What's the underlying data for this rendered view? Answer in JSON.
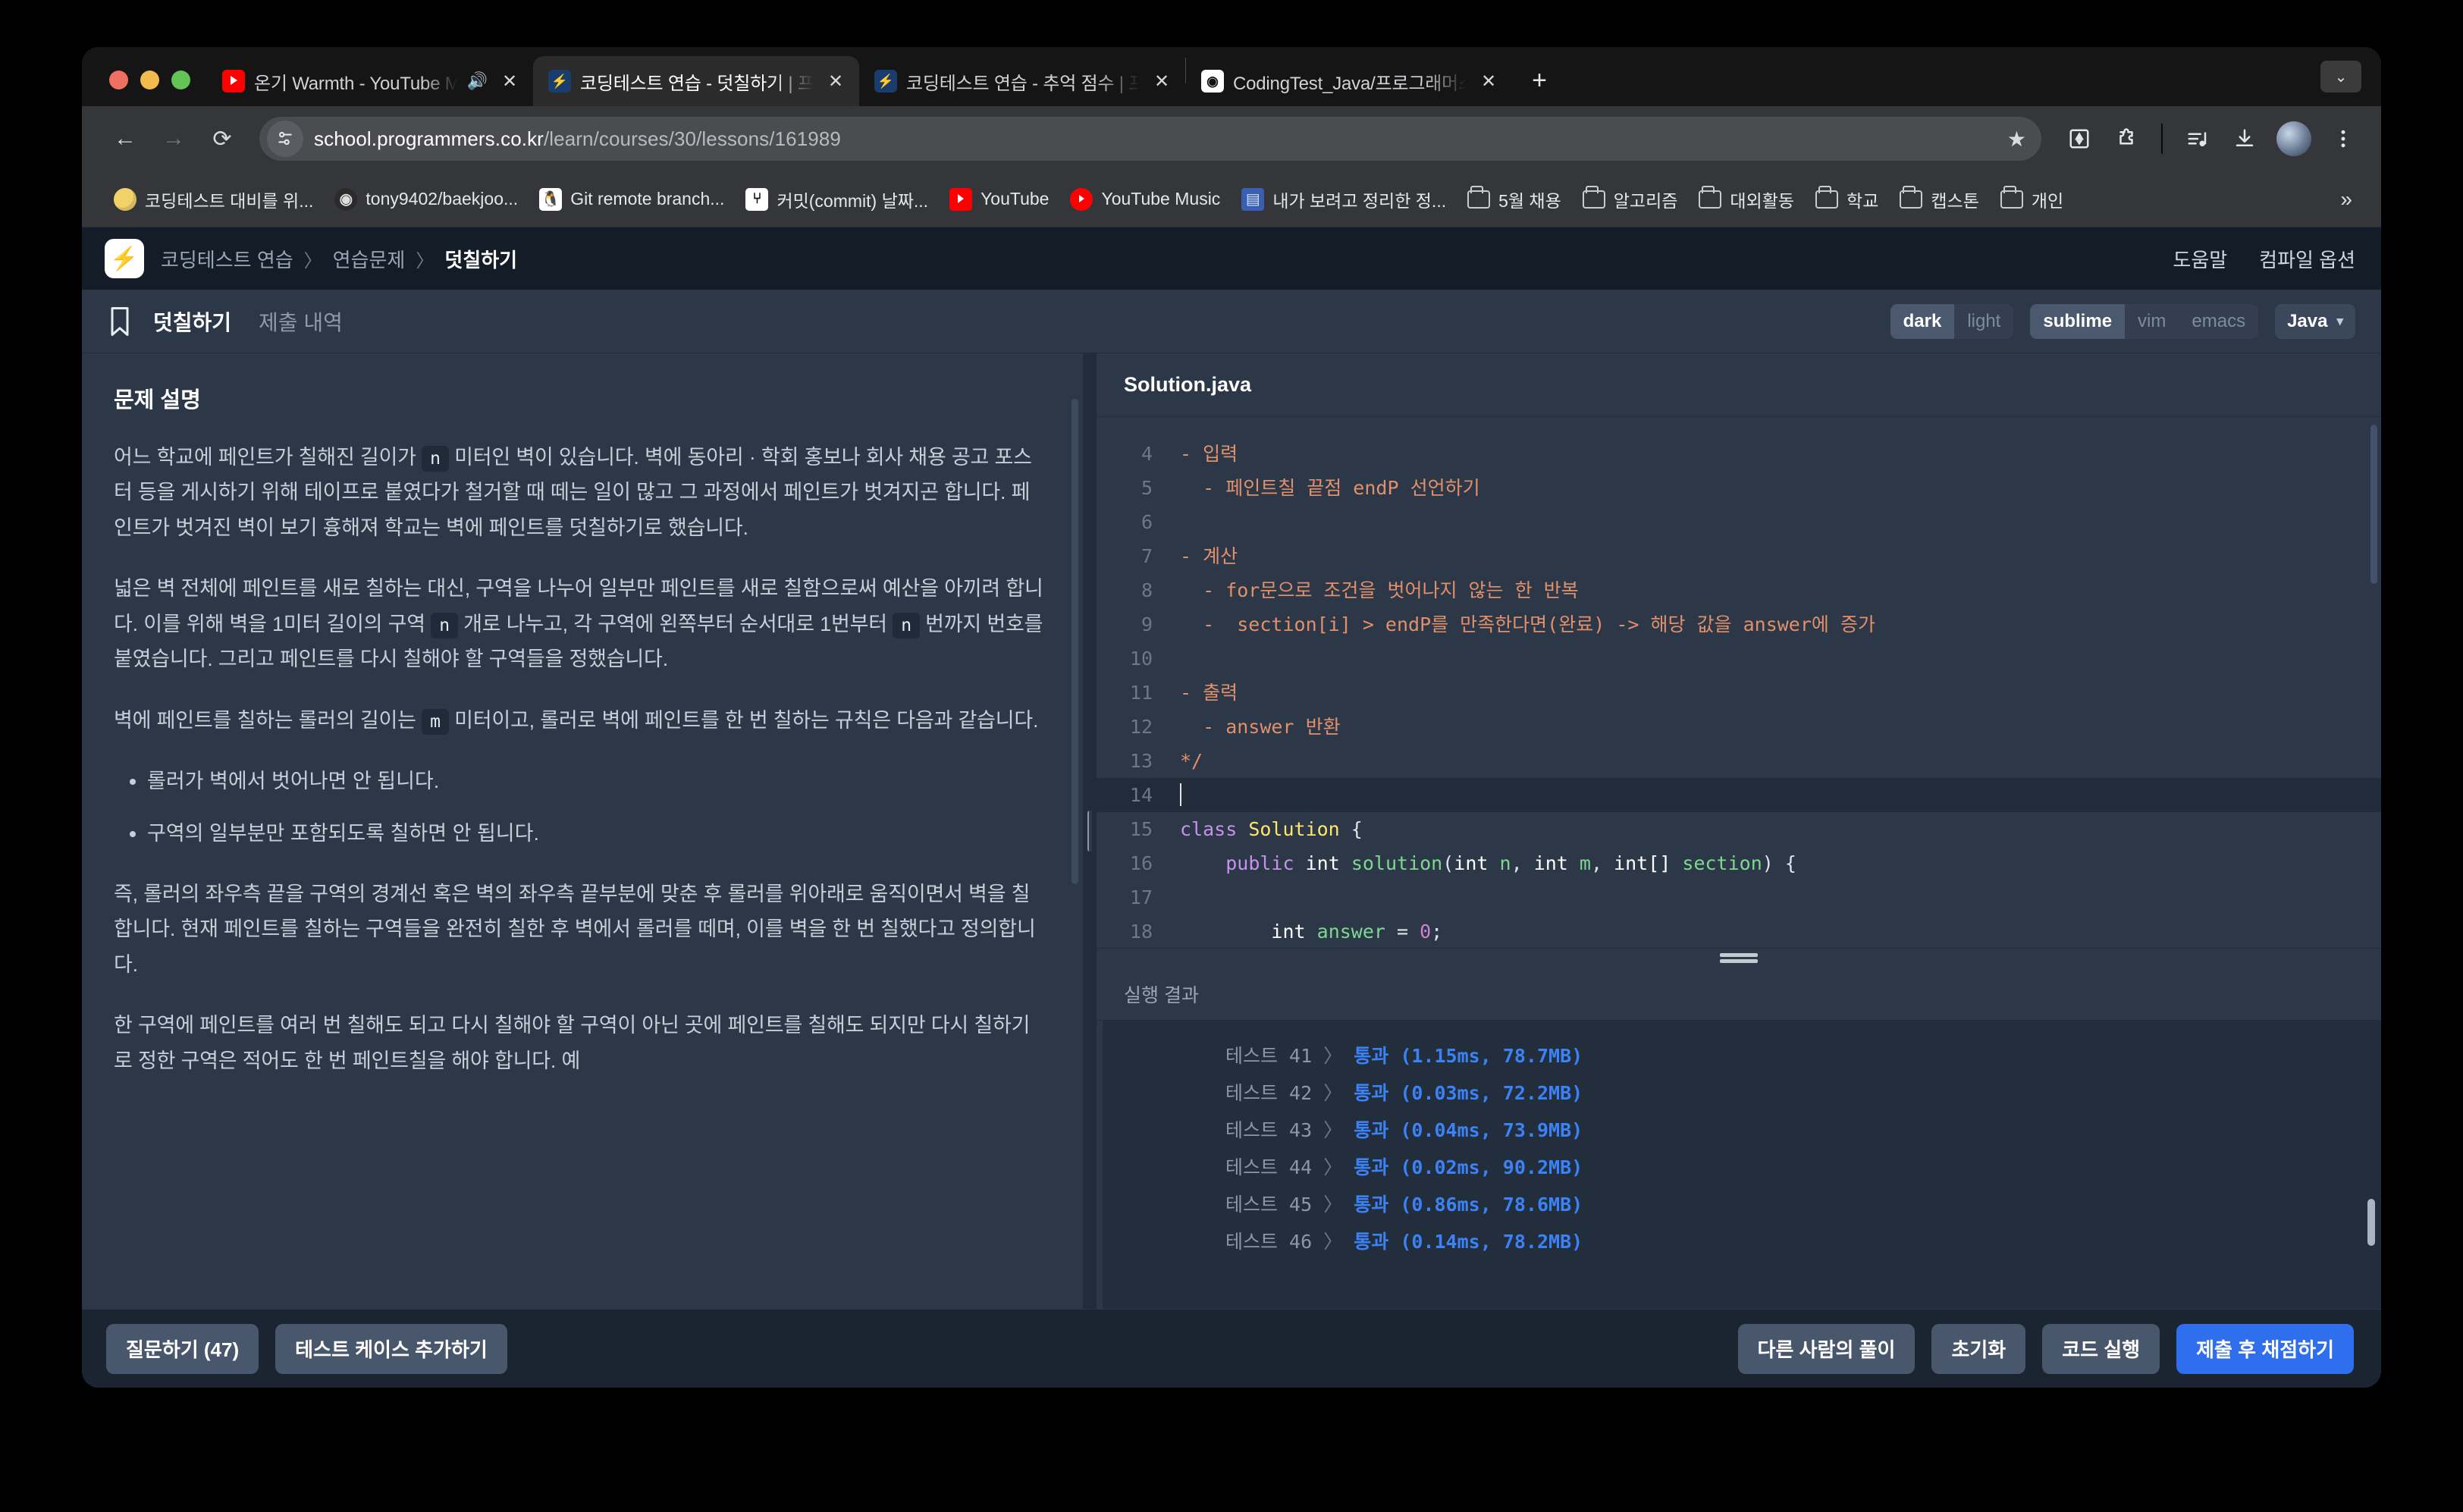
{
  "browser": {
    "tabs": [
      {
        "title": "온기 Warmth - YouTube Mu",
        "favicon": "youtube-icon",
        "audio": "🔊",
        "active": false
      },
      {
        "title": "코딩테스트 연습 - 덧칠하기 | 프로그",
        "favicon": "programmers-icon",
        "audio": "",
        "active": true
      },
      {
        "title": "코딩테스트 연습 - 추억 점수 | 프로그",
        "favicon": "programmers-icon",
        "audio": "",
        "active": false
      },
      {
        "title": "CodingTest_Java/프로그래머스/",
        "favicon": "github-icon",
        "audio": "",
        "active": false
      }
    ],
    "new_tab_label": "+",
    "tab_list_chevron": "⌄",
    "nav": {
      "back": "←",
      "forward": "→",
      "reload": "⟳"
    },
    "omnibox": {
      "host": "school.programmers.co.kr",
      "path": "/learn/courses/30/lessons/161989",
      "site_info_icon": "site-settings-icon",
      "star_icon": "★"
    },
    "toolbar_icons": [
      "reading-list-icon",
      "extensions-icon",
      "media-queue-icon",
      "downloads-icon",
      "profile-avatar",
      "more-menu-icon"
    ],
    "bookmarks": [
      {
        "label": "코딩테스트 대비를 위...",
        "icon": "coin-icon"
      },
      {
        "label": "tony9402/baekjoo...",
        "icon": "github-icon"
      },
      {
        "label": "Git remote branch...",
        "icon": "tux-icon"
      },
      {
        "label": "커밋(commit) 날짜...",
        "icon": "git-icon"
      },
      {
        "label": "YouTube",
        "icon": "youtube-icon"
      },
      {
        "label": "YouTube Music",
        "icon": "youtube-music-icon"
      },
      {
        "label": "내가 보려고 정리한 정...",
        "icon": "note-icon"
      },
      {
        "label": "5월 채용",
        "icon": "folder-icon"
      },
      {
        "label": "알고리즘",
        "icon": "folder-icon"
      },
      {
        "label": "대외활동",
        "icon": "folder-icon"
      },
      {
        "label": "학교",
        "icon": "folder-icon"
      },
      {
        "label": "캡스톤",
        "icon": "folder-icon"
      },
      {
        "label": "개인",
        "icon": "folder-icon"
      }
    ],
    "bookmarks_overflow": "»"
  },
  "site": {
    "logo": "programmers-logo",
    "breadcrumb": [
      "코딩테스트 연습",
      "연습문제",
      "덧칠하기"
    ],
    "breadcrumb_sep": "〉",
    "header_links": [
      "도움말",
      "컴파일 옵션"
    ],
    "tabs": [
      {
        "label": "덧칠하기",
        "active": true
      },
      {
        "label": "제출 내역",
        "active": false
      }
    ],
    "bookmark_icon": "bookmark-icon",
    "theme_toggle": {
      "options": [
        "dark",
        "light"
      ],
      "selected": "dark"
    },
    "keymap_toggle": {
      "options": [
        "sublime",
        "vim",
        "emacs"
      ],
      "selected": "sublime"
    },
    "language_select": {
      "value": "Java",
      "caret": "▾"
    }
  },
  "problem": {
    "title": "문제 설명",
    "paragraphs": [
      {
        "parts": [
          "어느 학교에 페인트가 칠해진 길이가 ",
          {
            "code": "n"
          },
          " 미터인 벽이 있습니다. 벽에 동아리 · 학회 홍보나 회사 채용 공고 포스터 등을 게시하기 위해 테이프로 붙였다가 철거할 때 떼는 일이 많고 그 과정에서 페인트가 벗겨지곤 합니다. 페인트가 벗겨진 벽이 보기 흉해져 학교는 벽에 페인트를 덧칠하기로 했습니다."
        ]
      },
      {
        "parts": [
          "넓은 벽 전체에 페인트를 새로 칠하는 대신, 구역을 나누어 일부만 페인트를 새로 칠함으로써 예산을 아끼려 합니다. 이를 위해 벽을 1미터 길이의 구역 ",
          {
            "code": "n"
          },
          " 개로 나누고, 각 구역에 왼쪽부터 순서대로 1번부터 ",
          {
            "code": "n"
          },
          " 번까지 번호를 붙였습니다. 그리고 페인트를 다시 칠해야 할 구역들을 정했습니다."
        ]
      },
      {
        "parts": [
          "벽에 페인트를 칠하는 롤러의 길이는 ",
          {
            "code": "m"
          },
          " 미터이고, 롤러로 벽에 페인트를 한 번 칠하는 규칙은 다음과 같습니다."
        ]
      }
    ],
    "rules": [
      "롤러가 벽에서 벗어나면 안 됩니다.",
      "구역의 일부분만 포함되도록 칠하면 안 됩니다."
    ],
    "paragraphs_after": [
      "즉, 롤러의 좌우측 끝을 구역의 경계선 혹은 벽의 좌우측 끝부분에 맞춘 후 롤러를 위아래로 움직이면서 벽을 칠합니다. 현재 페인트를 칠하는 구역들을 완전히 칠한 후 벽에서 롤러를 떼며, 이를 벽을 한 번 칠했다고 정의합니다.",
      "한 구역에 페인트를 여러 번 칠해도 되고 다시 칠해야 할 구역이 아닌 곳에 페인트를 칠해도 되지만 다시 칠하기로 정한 구역은 적어도 한 번 페인트칠을 해야 합니다. 예"
    ]
  },
  "editor": {
    "filename": "Solution.java",
    "lines": [
      {
        "num": "4",
        "tokens": [
          {
            "t": "- 입력",
            "c": "cm"
          }
        ]
      },
      {
        "num": "5",
        "tokens": [
          {
            "t": "  - 페인트칠 끝점 endP 선언하기",
            "c": "cm"
          }
        ]
      },
      {
        "num": "6",
        "tokens": [
          {
            "t": "",
            "c": "cm"
          }
        ]
      },
      {
        "num": "7",
        "tokens": [
          {
            "t": "- 계산",
            "c": "cm"
          }
        ]
      },
      {
        "num": "8",
        "tokens": [
          {
            "t": "  - for문으로 조건을 벗어나지 않는 한 반복",
            "c": "cm"
          }
        ]
      },
      {
        "num": "9",
        "tokens": [
          {
            "t": "  -  section[i] > endP를 만족한다면(완료) -> 해당 값을 answer에 증가",
            "c": "cm"
          }
        ]
      },
      {
        "num": "10",
        "tokens": [
          {
            "t": "",
            "c": "cm"
          }
        ]
      },
      {
        "num": "11",
        "tokens": [
          {
            "t": "- 출력",
            "c": "cm"
          }
        ]
      },
      {
        "num": "12",
        "tokens": [
          {
            "t": "  - answer 반환",
            "c": "cm"
          }
        ]
      },
      {
        "num": "13",
        "tokens": [
          {
            "t": "*/",
            "c": "cm"
          }
        ]
      },
      {
        "num": "14",
        "tokens": [
          {
            "t": "",
            "c": "pl"
          }
        ],
        "cursor": true
      },
      {
        "num": "15",
        "tokens": [
          {
            "t": "class ",
            "c": "kw"
          },
          {
            "t": "Solution",
            "c": "cls"
          },
          {
            "t": " {",
            "c": "pl"
          }
        ]
      },
      {
        "num": "16",
        "tokens": [
          {
            "t": "    ",
            "c": "pl"
          },
          {
            "t": "public",
            "c": "kw"
          },
          {
            "t": " ",
            "c": "pl"
          },
          {
            "t": "int",
            "c": "ty"
          },
          {
            "t": " ",
            "c": "pl"
          },
          {
            "t": "solution",
            "c": "fn"
          },
          {
            "t": "(",
            "c": "pl"
          },
          {
            "t": "int",
            "c": "ty"
          },
          {
            "t": " ",
            "c": "pl"
          },
          {
            "t": "n",
            "c": "fn"
          },
          {
            "t": ", ",
            "c": "pl"
          },
          {
            "t": "int",
            "c": "ty"
          },
          {
            "t": " ",
            "c": "pl"
          },
          {
            "t": "m",
            "c": "fn"
          },
          {
            "t": ", ",
            "c": "pl"
          },
          {
            "t": "int[]",
            "c": "ty"
          },
          {
            "t": " ",
            "c": "pl"
          },
          {
            "t": "section",
            "c": "fn"
          },
          {
            "t": ") {",
            "c": "pl"
          }
        ]
      },
      {
        "num": "17",
        "tokens": [
          {
            "t": "",
            "c": "pl"
          }
        ]
      },
      {
        "num": "18",
        "tokens": [
          {
            "t": "        ",
            "c": "pl"
          },
          {
            "t": "int",
            "c": "ty"
          },
          {
            "t": " ",
            "c": "pl"
          },
          {
            "t": "answer",
            "c": "fn"
          },
          {
            "t": " = ",
            "c": "pl"
          },
          {
            "t": "0",
            "c": "nm"
          },
          {
            "t": ";",
            "c": "pl"
          }
        ]
      }
    ]
  },
  "results": {
    "title": "실행 결과",
    "rows": [
      {
        "label": "테스트 41",
        "arrow": "〉",
        "status": "통과 (1.15ms, 78.7MB)"
      },
      {
        "label": "테스트 42",
        "arrow": "〉",
        "status": "통과 (0.03ms, 72.2MB)"
      },
      {
        "label": "테스트 43",
        "arrow": "〉",
        "status": "통과 (0.04ms, 73.9MB)"
      },
      {
        "label": "테스트 44",
        "arrow": "〉",
        "status": "통과 (0.02ms, 90.2MB)"
      },
      {
        "label": "테스트 45",
        "arrow": "〉",
        "status": "통과 (0.86ms, 78.6MB)"
      },
      {
        "label": "테스트 46",
        "arrow": "〉",
        "status": "통과 (0.14ms, 78.2MB)"
      }
    ]
  },
  "footer": {
    "left_buttons": [
      "질문하기 (47)",
      "테스트 케이스 추가하기"
    ],
    "right_buttons": [
      "다른 사람의 풀이",
      "초기화",
      "코드 실행"
    ],
    "primary_button": "제출 후 채점하기"
  },
  "colors": {
    "accent": "#2f6fed",
    "pass": "#3b82f6",
    "comment": "#e0906b",
    "page_bg": "#2c3748"
  }
}
